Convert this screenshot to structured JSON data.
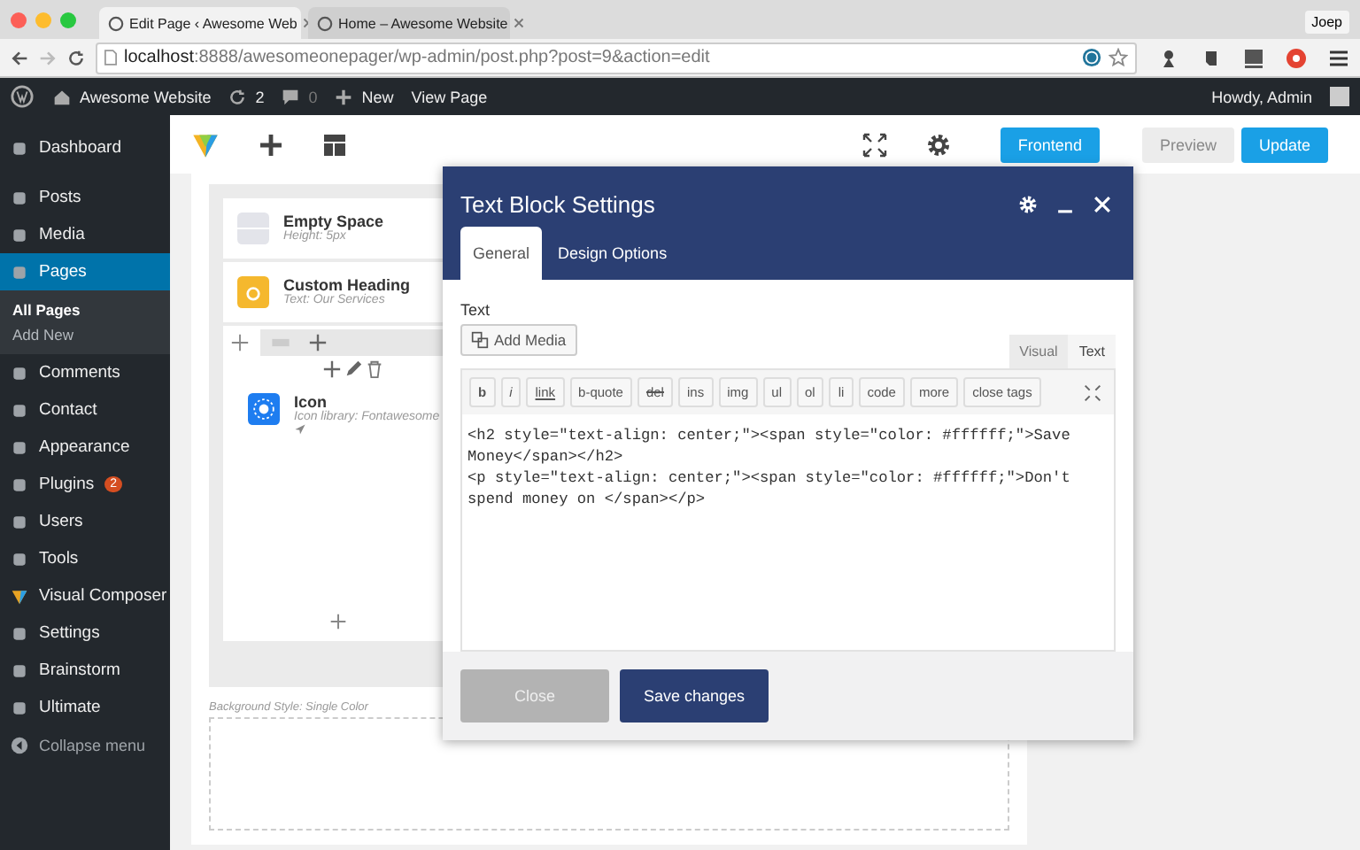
{
  "browser": {
    "tabs": [
      {
        "label": "Edit Page ‹ Awesome Web",
        "selected": true
      },
      {
        "label": "Home – Awesome Website",
        "selected": false
      }
    ],
    "profile": "Joep",
    "address_host": "localhost",
    "address_rest": ":8888/awesomeonepager/wp-admin/post.php?post=9&action=edit"
  },
  "admin_bar": {
    "site": "Awesome Website",
    "updates": "2",
    "comments": "0",
    "new": "New",
    "view": "View Page",
    "greeting": "Howdy, Admin"
  },
  "sidebar": {
    "items": [
      {
        "label": "Dashboard",
        "selected": false
      },
      {
        "label": "Posts",
        "selected": false
      },
      {
        "label": "Media",
        "selected": false
      },
      {
        "label": "Pages",
        "selected": true,
        "children": [
          {
            "label": "All Pages",
            "selected": true
          },
          {
            "label": "Add New",
            "selected": false
          }
        ]
      },
      {
        "label": "Comments",
        "selected": false
      },
      {
        "label": "Contact",
        "selected": false
      },
      {
        "label": "Appearance",
        "selected": false
      },
      {
        "label": "Plugins",
        "selected": false,
        "badge": "2"
      },
      {
        "label": "Users",
        "selected": false
      },
      {
        "label": "Tools",
        "selected": false
      },
      {
        "label": "Visual Composer",
        "selected": false
      },
      {
        "label": "Settings",
        "selected": false
      },
      {
        "label": "Brainstorm",
        "selected": false
      },
      {
        "label": "Ultimate",
        "selected": false
      }
    ],
    "collapse": "Collapse menu"
  },
  "toolbar": {
    "buttons": [
      "Frontend",
      "Preview",
      "Update"
    ]
  },
  "canvas": {
    "elements": [
      {
        "title": "Empty Space",
        "subtitle": "Height: 5px",
        "kind": "space"
      },
      {
        "title": "Custom Heading",
        "subtitle": "Text: Our Services",
        "kind": "heading"
      },
      {
        "title": "Icon",
        "subtitle": "Icon library: Fontawesome",
        "kind": "icon"
      }
    ],
    "background_note": "Background Style: Single Color"
  },
  "modal": {
    "title": "Text Block Settings",
    "tabs": [
      {
        "label": "General",
        "selected": true
      },
      {
        "label": "Design Options",
        "selected": false
      }
    ],
    "field_label": "Text",
    "add_media": "Add Media",
    "mode_tabs": [
      {
        "label": "Visual",
        "selected": false
      },
      {
        "label": "Text",
        "selected": true
      }
    ],
    "format_buttons": [
      {
        "label": "b",
        "kind": "bold"
      },
      {
        "label": "i",
        "kind": "italic"
      },
      {
        "label": "link",
        "kind": "link"
      },
      {
        "label": "b-quote",
        "kind": "plain"
      },
      {
        "label": "del",
        "kind": "strike"
      },
      {
        "label": "ins",
        "kind": "plain"
      },
      {
        "label": "img",
        "kind": "plain"
      },
      {
        "label": "ul",
        "kind": "plain"
      },
      {
        "label": "ol",
        "kind": "plain"
      },
      {
        "label": "li",
        "kind": "plain"
      },
      {
        "label": "code",
        "kind": "plain"
      },
      {
        "label": "more",
        "kind": "plain"
      },
      {
        "label": "close tags",
        "kind": "plain"
      }
    ],
    "code": "<h2 style=\"text-align: center;\"><span style=\"color: #ffffff;\">Save Money</span></h2>\n<p style=\"text-align: center;\"><span style=\"color: #ffffff;\">Don't spend money on </span></p>",
    "buttons": [
      {
        "label": "Close",
        "disabled": true
      },
      {
        "label": "Save changes",
        "disabled": false
      }
    ]
  }
}
